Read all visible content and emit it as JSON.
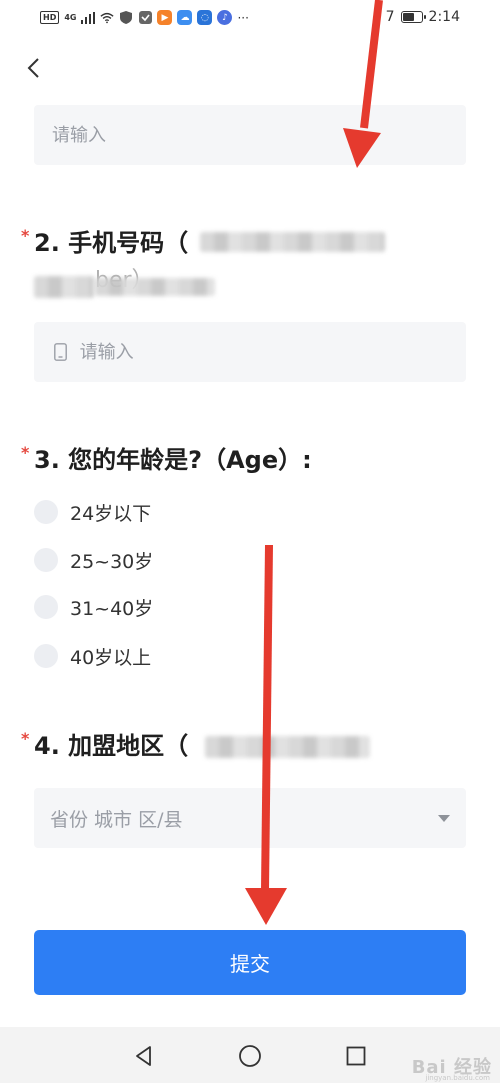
{
  "status_bar": {
    "network_badge": "HD",
    "signal_label": "4G",
    "battery_text": "7",
    "time": "2:14",
    "dots": "···",
    "battery_level": 0.7
  },
  "form": {
    "q1": {
      "placeholder": "请输入"
    },
    "q2": {
      "title": "2. 手机号码（",
      "title_tail": "ber）",
      "placeholder": "请输入"
    },
    "q3": {
      "title": "3. 您的年龄是?（Age）:",
      "options": [
        "24岁以下",
        "25~30岁",
        "31~40岁",
        "40岁以上"
      ]
    },
    "q4": {
      "title": "4. 加盟地区（",
      "placeholder": "省份 城市 区/县"
    },
    "required_mark": "*",
    "submit_label": "提交"
  },
  "watermark": {
    "text": "Bai 经验",
    "sub": "jingyan.baidu.com"
  },
  "icons": {
    "back": "chevron-left-icon",
    "phone": "phone-icon",
    "dropdown": "caret-down-icon",
    "nav": [
      "nav-back-icon",
      "nav-home-icon",
      "nav-recent-icon"
    ]
  },
  "colors": {
    "primary": "#2d7ef4",
    "required": "#e5483f",
    "field_bg": "#f5f6f8",
    "annotation_arrow": "#e53a2e"
  }
}
